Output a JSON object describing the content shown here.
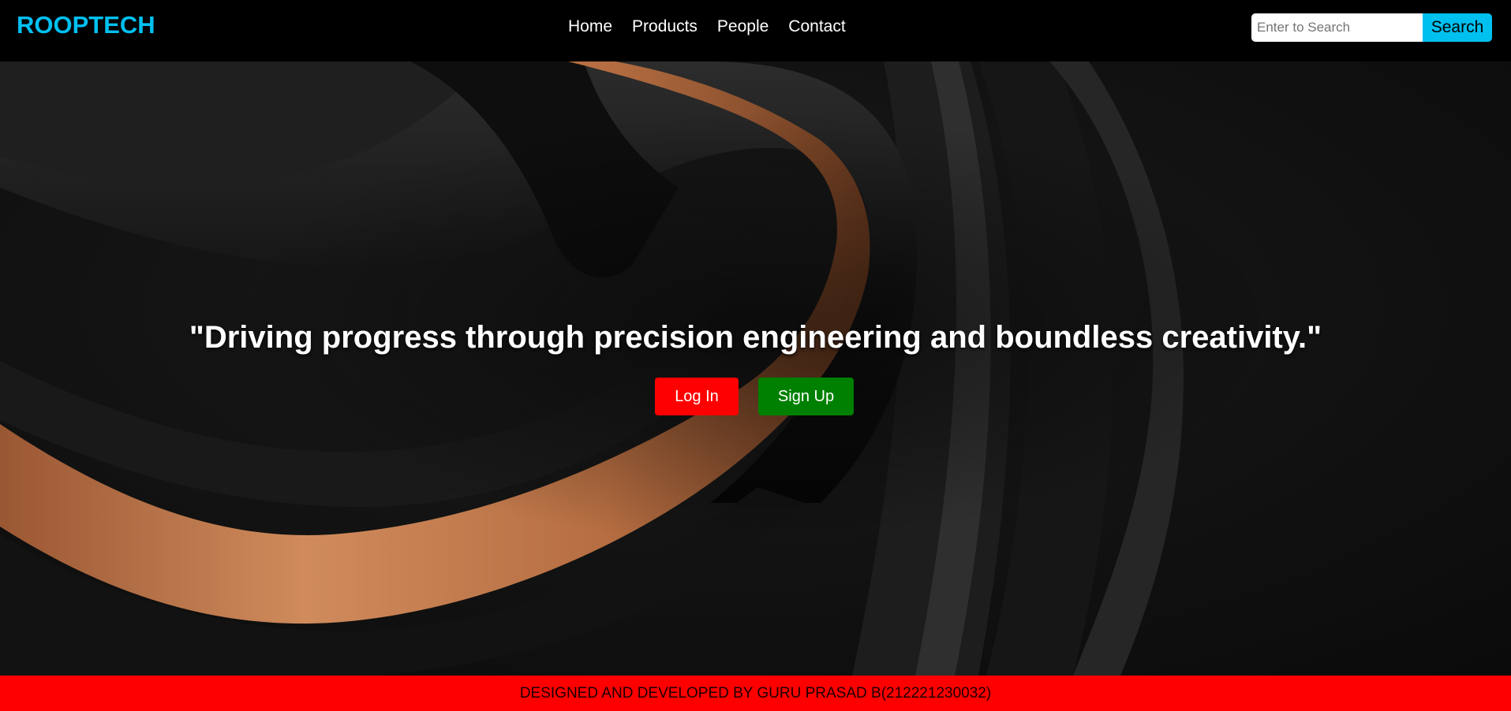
{
  "header": {
    "brand": "ROOPTECH",
    "nav": [
      "Home",
      "Products",
      "People",
      "Contact"
    ],
    "search": {
      "placeholder": "Enter to Search",
      "button_label": "Search"
    }
  },
  "hero": {
    "tagline": "\"Driving progress through precision engineering and boundless creativity.\"",
    "login_label": "Log In",
    "signup_label": "Sign Up"
  },
  "footer": {
    "text": "DESIGNED AND DEVELOPED BY GURU PRASAD B(212221230032)"
  },
  "colors": {
    "brand": "#00c0f0",
    "search_button": "#00c0f0",
    "login_button": "#ff0000",
    "signup_button": "#008000",
    "footer_bg": "#ff0000",
    "hero_accent": "#c77a4a"
  }
}
